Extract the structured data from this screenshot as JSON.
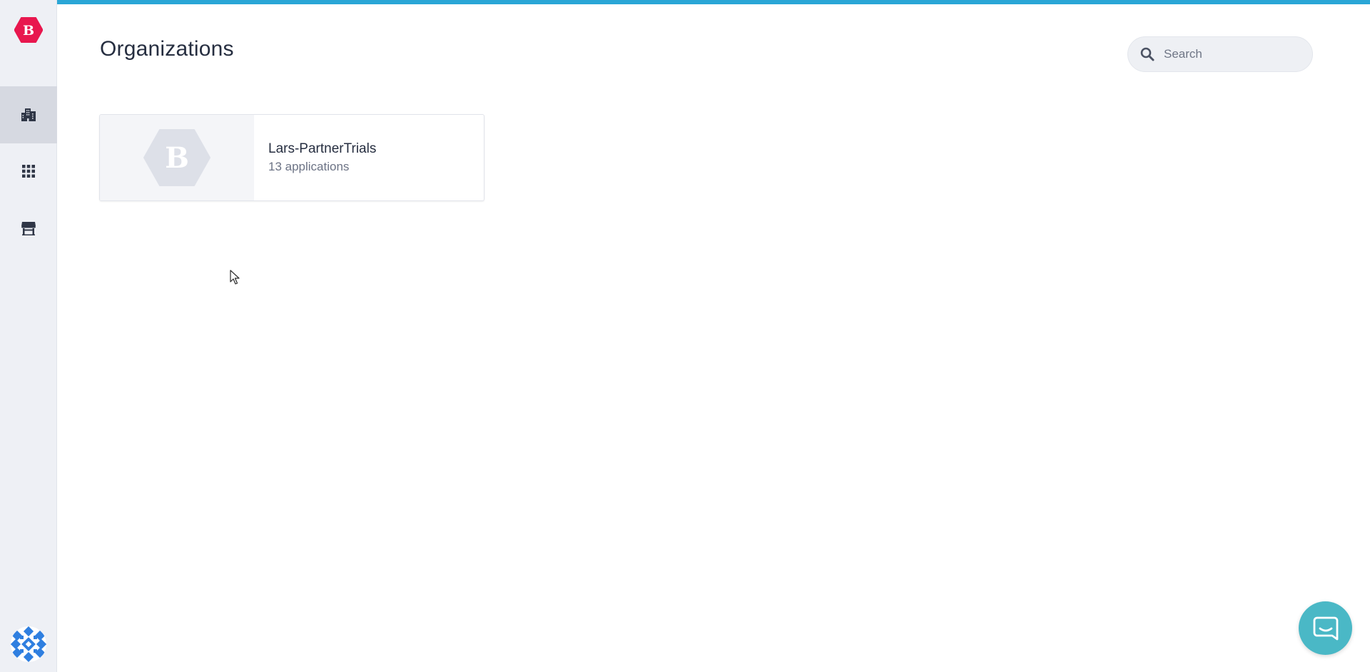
{
  "brand": {
    "logo_letter": "B",
    "logo_color": "#e8174e"
  },
  "sidebar": {
    "items": [
      {
        "name": "organizations",
        "icon": "building-icon",
        "active": true
      },
      {
        "name": "applications",
        "icon": "grid-icon",
        "active": false
      },
      {
        "name": "store",
        "icon": "storefront-icon",
        "active": false
      }
    ]
  },
  "header": {
    "title": "Organizations"
  },
  "search": {
    "placeholder": "Search",
    "value": ""
  },
  "organizations": [
    {
      "name": "Lars-PartnerTrials",
      "count_label": "13 applications",
      "thumb_letter": "B"
    }
  ],
  "colors": {
    "accent": "#2aa6d6",
    "chat": "#4ab8c6",
    "sidebar_bg": "#eef0f5"
  }
}
